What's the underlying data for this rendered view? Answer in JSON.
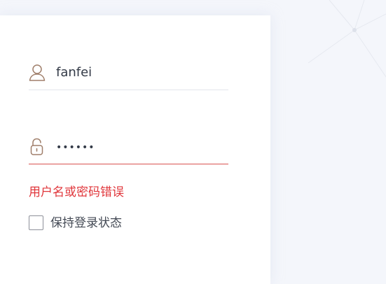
{
  "login": {
    "username": {
      "icon": "user-icon",
      "value": "fanfei"
    },
    "password": {
      "icon": "lock-icon",
      "value": "••••••"
    },
    "error_message": "用户名或密码错误",
    "remember_me": {
      "label": "保持登录状态",
      "checked": false
    }
  },
  "colors": {
    "error": "#e0353a",
    "icon": "#a07f6b",
    "background": "#f4f6fb",
    "card": "#ffffff"
  }
}
